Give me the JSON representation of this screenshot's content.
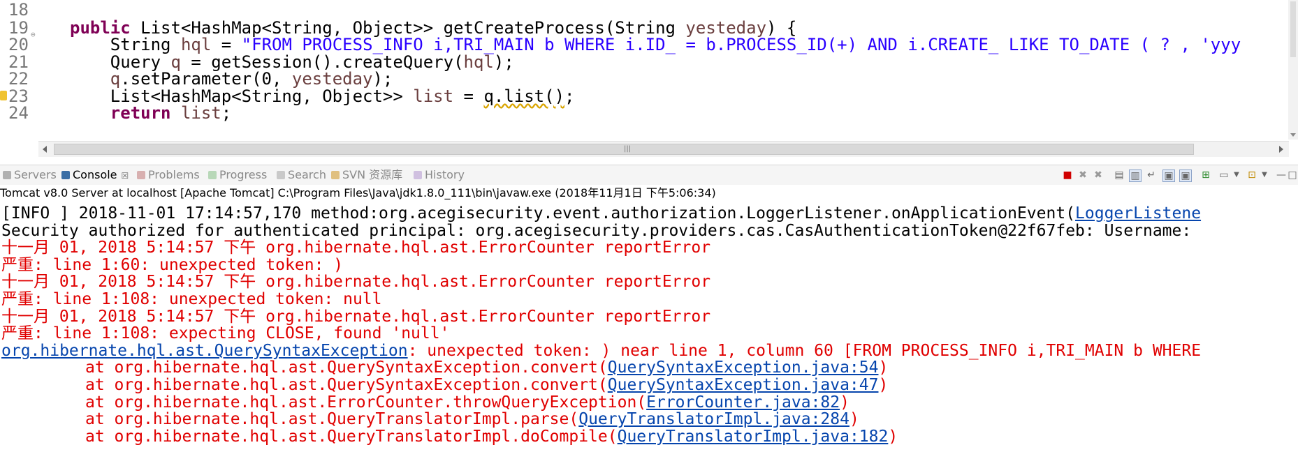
{
  "editor": {
    "lines": [
      {
        "num": "18"
      },
      {
        "num": "19",
        "fold": "⊖",
        "parts": [
          {
            "t": "public",
            "c": "kw"
          },
          {
            "t": " List<HashMap<String, Object>> getCreateProcess(String ",
            "c": ""
          },
          {
            "t": "yesteday",
            "c": "var"
          },
          {
            "t": ") {",
            "c": ""
          }
        ]
      },
      {
        "num": "20",
        "parts": [
          {
            "t": "    String ",
            "c": ""
          },
          {
            "t": "hql",
            "c": "var"
          },
          {
            "t": " = ",
            "c": ""
          },
          {
            "t": "\"FROM PROCESS_INFO i,TRI_MAIN b WHERE i.ID_ = b.PROCESS_ID(+) AND i.CREATE_ LIKE TO_DATE ( ? , 'yyy",
            "c": "str"
          }
        ]
      },
      {
        "num": "21",
        "parts": [
          {
            "t": "    Query ",
            "c": ""
          },
          {
            "t": "q",
            "c": "var"
          },
          {
            "t": " = getSession().createQuery(",
            "c": ""
          },
          {
            "t": "hql",
            "c": "var"
          },
          {
            "t": ");",
            "c": ""
          }
        ]
      },
      {
        "num": "22",
        "parts": [
          {
            "t": "    ",
            "c": ""
          },
          {
            "t": "q",
            "c": "var"
          },
          {
            "t": ".setParameter(0, ",
            "c": ""
          },
          {
            "t": "yesteday",
            "c": "var"
          },
          {
            "t": ");",
            "c": ""
          }
        ]
      },
      {
        "num": "23",
        "marker": true,
        "parts": [
          {
            "t": "    List<HashMap<String, Object>> ",
            "c": ""
          },
          {
            "t": "list",
            "c": "var"
          },
          {
            "t": " = ",
            "c": ""
          },
          {
            "t": "q.list()",
            "c": "warn"
          },
          {
            "t": ";",
            "c": ""
          }
        ]
      },
      {
        "num": "24",
        "parts": [
          {
            "t": "    ",
            "c": ""
          },
          {
            "t": "return",
            "c": "kw"
          },
          {
            "t": " ",
            "c": ""
          },
          {
            "t": "list",
            "c": "var"
          },
          {
            "t": ";",
            "c": ""
          }
        ]
      }
    ]
  },
  "tabs": {
    "servers": "Servers",
    "console": "Console",
    "console_close": "☒",
    "problems": "Problems",
    "progress": "Progress",
    "search": "Search",
    "svn": "SVN 资源库",
    "history": "History"
  },
  "icons": {
    "terminate": "stop-icon",
    "remove": "remove-launch-icon",
    "remove_all": "remove-all-icon",
    "clear": "clear-console-icon",
    "scroll_lock": "scroll-lock-icon",
    "word_wrap": "word-wrap-icon",
    "show_out": "show-stdout-icon",
    "show_err": "show-stderr-icon",
    "pin": "pin-console-icon",
    "display": "display-console-icon",
    "open": "open-console-icon",
    "minimize": "minimize-icon",
    "maximize": "maximize-icon"
  },
  "console": {
    "launch_label": "Tomcat v8.0 Server at localhost [Apache Tomcat] C:\\Program Files\\Java\\jdk1.8.0_111\\bin\\javaw.exe (2018年11月1日 下午5:06:34)",
    "lines": [
      {
        "parts": [
          {
            "t": "[INFO ] 2018-11-01 17:14:57,170 method:org.acegisecurity.event.authorization.LoggerListener.onApplicationEvent(",
            "c": "black"
          },
          {
            "t": "LoggerListene",
            "c": "link"
          }
        ]
      },
      {
        "parts": [
          {
            "t": "Security authorized for authenticated principal: org.acegisecurity.providers.cas.CasAuthenticationToken@22f67feb: Username: ",
            "c": "black"
          }
        ]
      },
      {
        "parts": [
          {
            "t": "十一月 01, 2018 5:14:57 下午 org.hibernate.hql.ast.ErrorCounter reportError",
            "c": "red"
          }
        ]
      },
      {
        "parts": [
          {
            "t": "严重: line 1:60: unexpected token: )",
            "c": "red"
          }
        ]
      },
      {
        "parts": [
          {
            "t": "十一月 01, 2018 5:14:57 下午 org.hibernate.hql.ast.ErrorCounter reportError",
            "c": "red"
          }
        ]
      },
      {
        "parts": [
          {
            "t": "严重: line 1:108: unexpected token: null",
            "c": "red"
          }
        ]
      },
      {
        "parts": [
          {
            "t": "十一月 01, 2018 5:14:57 下午 org.hibernate.hql.ast.ErrorCounter reportError",
            "c": "red"
          }
        ]
      },
      {
        "parts": [
          {
            "t": "严重: line 1:108: expecting CLOSE, found 'null'",
            "c": "red"
          }
        ]
      },
      {
        "parts": [
          {
            "t": "org.hibernate.hql.ast.QuerySyntaxException",
            "c": "link"
          },
          {
            "t": ": unexpected token: ) near line 1, column 60 [FROM PROCESS_INFO i,TRI_MAIN b WHERE",
            "c": "red"
          }
        ]
      },
      {
        "indent": true,
        "parts": [
          {
            "t": "at org.hibernate.hql.ast.QuerySyntaxException.convert(",
            "c": "red"
          },
          {
            "t": "QuerySyntaxException.java:54",
            "c": "link"
          },
          {
            "t": ")",
            "c": "red"
          }
        ]
      },
      {
        "indent": true,
        "parts": [
          {
            "t": "at org.hibernate.hql.ast.QuerySyntaxException.convert(",
            "c": "red"
          },
          {
            "t": "QuerySyntaxException.java:47",
            "c": "link"
          },
          {
            "t": ")",
            "c": "red"
          }
        ]
      },
      {
        "indent": true,
        "parts": [
          {
            "t": "at org.hibernate.hql.ast.ErrorCounter.throwQueryException(",
            "c": "red"
          },
          {
            "t": "ErrorCounter.java:82",
            "c": "link"
          },
          {
            "t": ")",
            "c": "red"
          }
        ]
      },
      {
        "indent": true,
        "parts": [
          {
            "t": "at org.hibernate.hql.ast.QueryTranslatorImpl.parse(",
            "c": "red"
          },
          {
            "t": "QueryTranslatorImpl.java:284",
            "c": "link"
          },
          {
            "t": ")",
            "c": "red"
          }
        ]
      },
      {
        "indent": true,
        "parts": [
          {
            "t": "at org.hibernate.hql.ast.QueryTranslatorImpl.doCompile(",
            "c": "red"
          },
          {
            "t": "QueryTranslatorImpl.java:182",
            "c": "link"
          },
          {
            "t": ")",
            "c": "red"
          }
        ]
      }
    ]
  },
  "colors": {
    "keyword": "#7f0055",
    "variable": "#6a3e3e",
    "string": "#2a00ff",
    "error": "#e00000",
    "link": "#0645ad"
  }
}
